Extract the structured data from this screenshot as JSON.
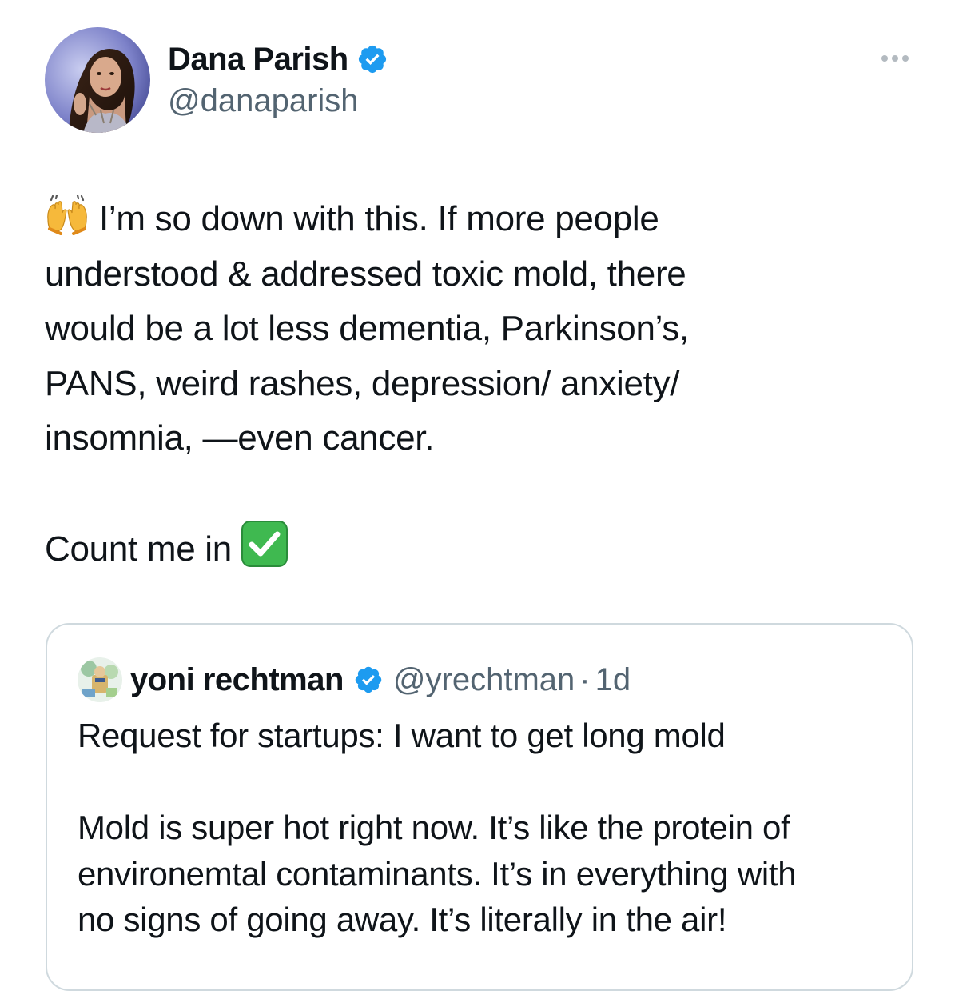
{
  "tweet": {
    "author": {
      "name": "Dana Parish",
      "handle": "@danaparish",
      "verified": true,
      "avatar_icon": "profile-photo"
    },
    "more_icon": "more-options-icon",
    "text_lines": [
      "I’m so down with this. If more people",
      "understood & addressed toxic mold, there",
      "would be a lot less dementia, Parkinson’s,",
      "PANS, weird rashes, depression/ anxiety/",
      "insomnia, —even cancer."
    ],
    "leading_emoji": "raising-hands-emoji",
    "closing_line": "Count me in",
    "closing_emoji": "check-mark-button-emoji"
  },
  "quote": {
    "author": {
      "name": "yoni rechtman",
      "handle": "@yrechtman",
      "separator": "·",
      "time": "1d",
      "verified": true
    },
    "paragraph1": "Request for startups: I want to get long mold",
    "paragraph2_lines": [
      "Mold is super hot right now. It’s like the protein of",
      "environemtal contaminants. It’s in everything with",
      "no signs of going away. It’s literally in the air!"
    ]
  },
  "colors": {
    "text": "#0f1419",
    "secondary": "#536471",
    "verified_blue": "#1d9bf0",
    "card_border": "#cfd9de",
    "check_green": "#2ea043"
  }
}
